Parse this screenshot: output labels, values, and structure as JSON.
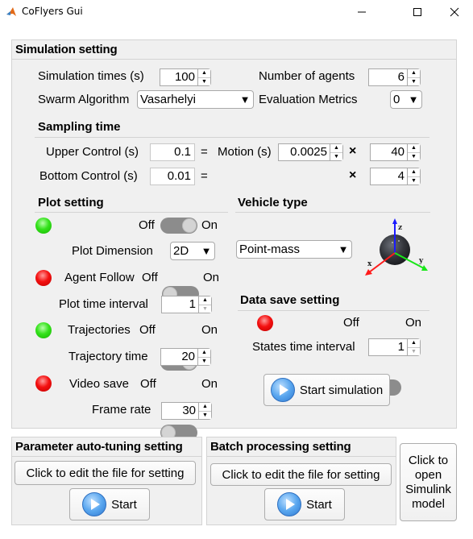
{
  "window": {
    "title": "CoFlyers Gui",
    "minimize_glyph": "—",
    "maximize_glyph": "☐",
    "close_glyph": "✕"
  },
  "simulation_setting": {
    "title": "Simulation setting",
    "simulation_times": {
      "label": "Simulation times (s)",
      "value": "100"
    },
    "number_of_agents": {
      "label": "Number of agents",
      "value": "6"
    },
    "swarm_algorithm": {
      "label": "Swarm Algorithm",
      "value": "Vasarhelyi"
    },
    "evaluation_metrics": {
      "label": "Evaluation Metrics",
      "value": "0"
    },
    "sampling_time": {
      "title": "Sampling time",
      "upper_control": {
        "label": "Upper Control (s)",
        "value": "0.1"
      },
      "bottom_control": {
        "label": "Bottom Control (s)",
        "value": "0.01"
      },
      "equals": "=",
      "times": "×",
      "motion": {
        "label": "Motion (s)",
        "value": "0.0025"
      },
      "upper_multiplier": "40",
      "bottom_multiplier": "4"
    }
  },
  "plot_setting": {
    "title": "Plot setting",
    "plot_switch": {
      "off": "Off",
      "on": "On",
      "state": "on",
      "lamp": "green"
    },
    "plot_dimension": {
      "label": "Plot Dimension",
      "value": "2D"
    },
    "agent_follow": {
      "label": "Agent Follow",
      "off": "Off",
      "on": "On",
      "state": "off",
      "lamp": "red"
    },
    "plot_time_interval": {
      "label": "Plot time interval",
      "value": "1"
    },
    "trajectories": {
      "label": "Trajectories",
      "off": "Off",
      "on": "On",
      "state": "on",
      "lamp": "green"
    },
    "trajectory_time": {
      "label": "Trajectory time",
      "value": "20"
    },
    "video_save": {
      "label": "Video save",
      "off": "Off",
      "on": "On",
      "state": "off",
      "lamp": "red"
    },
    "frame_rate": {
      "label": "Frame rate",
      "value": "30"
    }
  },
  "vehicle_type": {
    "title": "Vehicle type",
    "value": "Point-mass",
    "axes": {
      "x": "x",
      "y": "y",
      "z": "z"
    },
    "colors": {
      "x": "#ff1a1a",
      "y": "#19e619",
      "z": "#1a1aff"
    }
  },
  "data_save_setting": {
    "title": "Data save setting",
    "switch": {
      "off": "Off",
      "on": "On",
      "state": "off",
      "lamp": "red"
    },
    "states_time_interval": {
      "label": "States time interval",
      "value": "1"
    }
  },
  "start_simulation_label": "Start simulation",
  "parameter_auto_tuning": {
    "title": "Parameter auto-tuning setting",
    "edit_label": "Click to edit the file for setting",
    "start_label": "Start"
  },
  "batch_processing": {
    "title": "Batch processing setting",
    "edit_label": "Click to edit the file for setting",
    "start_label": "Start"
  },
  "simulink_button_lines": [
    "Click to",
    "open",
    "Simulink",
    "model"
  ]
}
